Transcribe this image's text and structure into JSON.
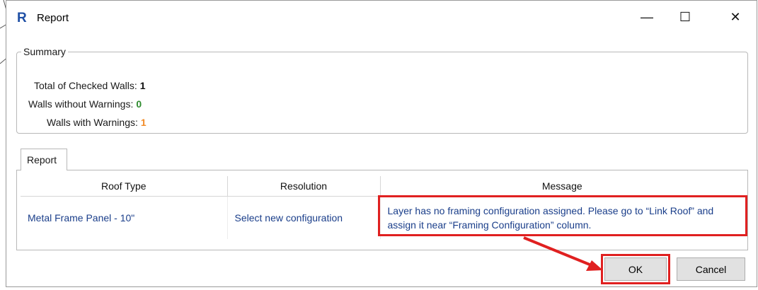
{
  "window": {
    "icon_letter": "R",
    "title": "Report",
    "minimize_glyph": "—",
    "maximize_glyph": "☐",
    "close_glyph": "✕"
  },
  "summary": {
    "legend": "Summary",
    "rows": [
      {
        "label": "Total of Checked Walls:",
        "value": "1",
        "color": "#111111"
      },
      {
        "label": "Walls without Warnings:",
        "value": "0",
        "color": "#2e8b2e"
      },
      {
        "label": "Walls with Warnings:",
        "value": "1",
        "color": "#f28c28"
      }
    ]
  },
  "tabs": [
    {
      "label": "Report"
    }
  ],
  "table": {
    "columns": [
      "Roof Type",
      "Resolution",
      "Message"
    ],
    "rows": [
      {
        "roof_type": "Metal Frame Panel - 10\"",
        "resolution": "Select new configuration",
        "message": "Layer has no framing configuration assigned. Please go to “Link Roof” and assign it near “Framing Configuration” column."
      }
    ]
  },
  "buttons": {
    "ok": "OK",
    "cancel": "Cancel"
  },
  "annotation": {
    "color": "#e02020"
  }
}
